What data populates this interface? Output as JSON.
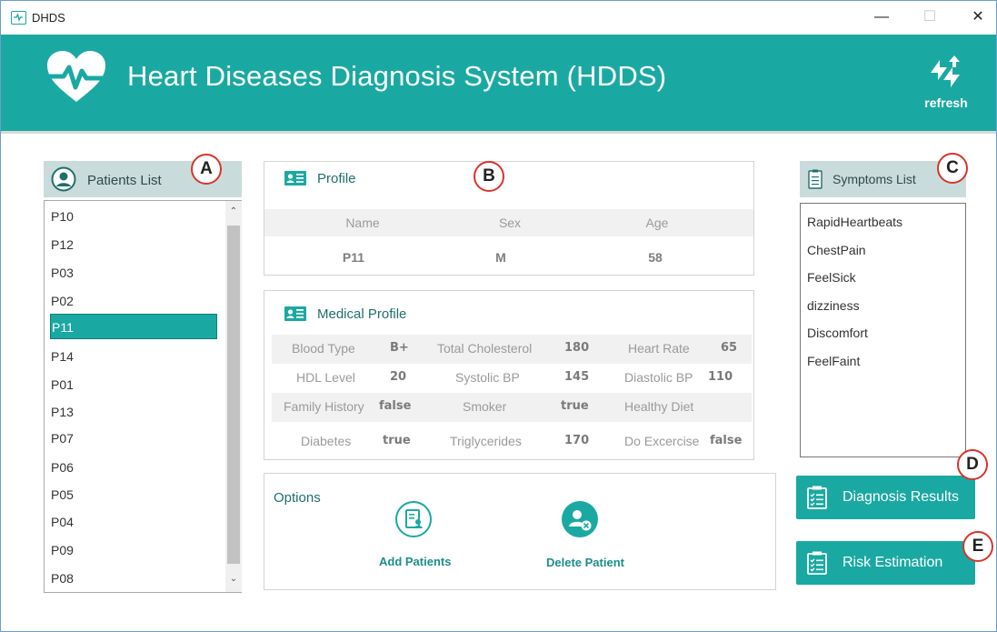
{
  "window": {
    "title": "DHDS",
    "minimize_glyph": "—",
    "maximize_glyph": "☐",
    "close_glyph": "✕"
  },
  "header": {
    "title": "Heart Diseases Diagnosis System (HDDS)",
    "refresh_label": "refresh",
    "logo_icon": "heart-pulse-icon",
    "bg_color": "#1aa9a2"
  },
  "badges": {
    "a": "A",
    "b": "B",
    "c": "C",
    "d": "D",
    "e": "E"
  },
  "patients": {
    "title": "Patients List",
    "items": [
      "P10",
      "P12",
      "P03",
      "P02",
      "P11",
      "P14",
      "P01",
      "P13",
      "P07",
      "P06",
      "P05",
      "P04",
      "P09",
      "P08"
    ],
    "selected": "P11"
  },
  "profile": {
    "title": "Profile",
    "headers": {
      "name": "Name",
      "sex": "Sex",
      "age": "Age"
    },
    "values": {
      "name": "P11",
      "sex": "M",
      "age": "58"
    }
  },
  "medical": {
    "title": "Medical Profile",
    "blood_type_label": "Blood Type",
    "blood_type": "B+",
    "total_cholesterol_label": "Total Cholesterol",
    "total_cholesterol": "180",
    "heart_rate_label": "Heart Rate",
    "heart_rate": "65",
    "hdl_label": "HDL Level",
    "hdl": "20",
    "systolic_label": "Systolic BP",
    "systolic": "145",
    "diastolic_label": "Diastolic BP",
    "diastolic": "110",
    "family_history_label": "Family History",
    "family_history": "false",
    "smoker_label": "Smoker",
    "smoker": "true",
    "healthy_diet_label": "Healthy Diet",
    "healthy_diet": "",
    "diabetes_label": "Diabetes",
    "diabetes": "true",
    "triglycerides_label": "Triglycerides",
    "triglycerides": "170",
    "exercise_label": "Do Excercise",
    "exercise": "false"
  },
  "options": {
    "title": "Options",
    "add_label": "Add Patients",
    "delete_label": "Delete Patient"
  },
  "symptoms": {
    "title": "Symptoms List",
    "items": [
      "RapidHeartbeats",
      "ChestPain",
      "FeelSick",
      "dizziness",
      "Discomfort",
      "FeelFaint"
    ]
  },
  "actions": {
    "diagnosis_label": "Diagnosis Results",
    "risk_label": "Risk Estimation"
  }
}
